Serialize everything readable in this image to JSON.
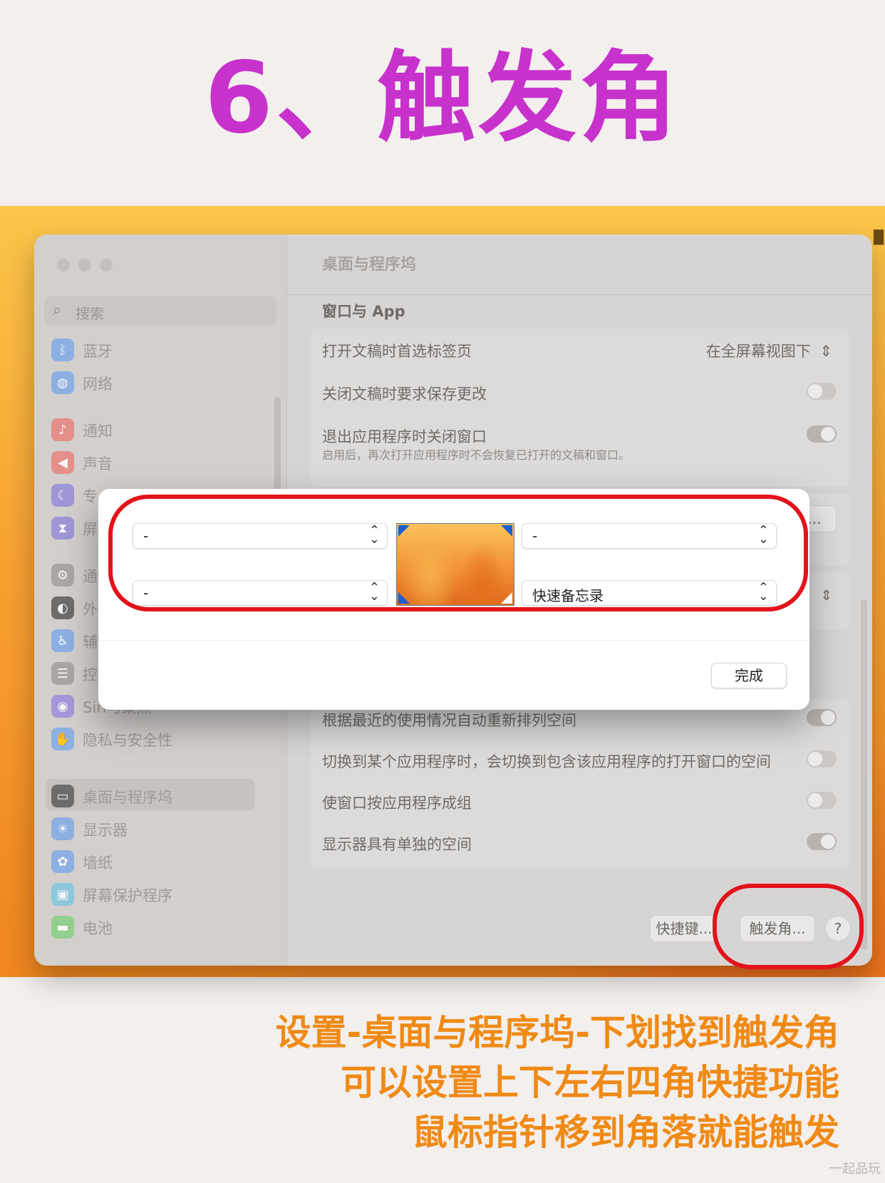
{
  "headline": "6、触发角",
  "window": {
    "title": "桌面与程序坞",
    "search_placeholder": "搜索",
    "sidebar": [
      {
        "label": "蓝牙",
        "icon": "bluetooth-icon",
        "color": "#8db0e2"
      },
      {
        "label": "网络",
        "icon": "globe-icon",
        "color": "#8db0e2"
      },
      {
        "label": "通知",
        "icon": "bell-icon",
        "color": "#e48f8a"
      },
      {
        "label": "声音",
        "icon": "speaker-icon",
        "color": "#e48f8a"
      },
      {
        "label": "专",
        "icon": "moon-icon",
        "color": "#9f96d6"
      },
      {
        "label": "屏",
        "icon": "hourglass-icon",
        "color": "#9f96d6"
      },
      {
        "label": "通",
        "icon": "gear-icon",
        "color": "#a9a6a4"
      },
      {
        "label": "外",
        "icon": "appearance-icon",
        "color": "#6e6c6a"
      },
      {
        "label": "辅",
        "icon": "accessibility-icon",
        "color": "#8db0e2"
      },
      {
        "label": "控",
        "icon": "control-center-icon",
        "color": "#a9a6a4"
      },
      {
        "label": "Siri与聚焦",
        "icon": "siri-icon",
        "color": "#a597d9"
      },
      {
        "label": "隐私与安全性",
        "icon": "hand-icon",
        "color": "#8db0e2"
      },
      {
        "label": "桌面与程序坞",
        "icon": "dock-icon",
        "color": "#6e6c6a"
      },
      {
        "label": "显示器",
        "icon": "sun-icon",
        "color": "#8db0e2"
      },
      {
        "label": "墙纸",
        "icon": "flower-icon",
        "color": "#8db0e2"
      },
      {
        "label": "屏幕保护程序",
        "icon": "screensaver-icon",
        "color": "#8dc7dc"
      },
      {
        "label": "电池",
        "icon": "battery-icon",
        "color": "#92cf8e"
      }
    ],
    "section_title": "窗口与 App",
    "settings_top": {
      "prefer_tabs_label": "打开文稿时首选标签页",
      "prefer_tabs_value": "在全屏幕视图下",
      "ask_keep_changes_label": "关闭文稿时要求保存更改",
      "close_windows_label": "退出应用程序时关闭窗口",
      "close_windows_desc": "启用后，再次打开应用程序时不会恢复已打开的文稿和窗口。"
    },
    "settings_bottom": [
      {
        "label": "根据最近的使用情况自动重新排列空间",
        "on": true
      },
      {
        "label": "切换到某个应用程序时，会切换到包含该应用程序的打开窗口的空间",
        "on": false
      },
      {
        "label": "使窗口按应用程序成组",
        "on": false
      },
      {
        "label": "显示器具有单独的空间",
        "on": true
      }
    ],
    "partial_button": "...",
    "shortcuts_button": "快捷键...",
    "hot_corners_button": "触发角...",
    "help_button": "?"
  },
  "hot_corners_dialog": {
    "top_left": "-",
    "top_right": "-",
    "bottom_left": "-",
    "bottom_right": "快速备忘录",
    "done_button": "完成"
  },
  "caption": [
    "设置-桌面与程序坞-下划找到触发角",
    "可以设置上下左右四角快捷功能",
    "鼠标指针移到角落就能触发"
  ],
  "watermark": "一起品玩",
  "colors": {
    "headline": "#c832cc",
    "caption": "#f08a16",
    "highlight_ring": "#e3121b"
  }
}
